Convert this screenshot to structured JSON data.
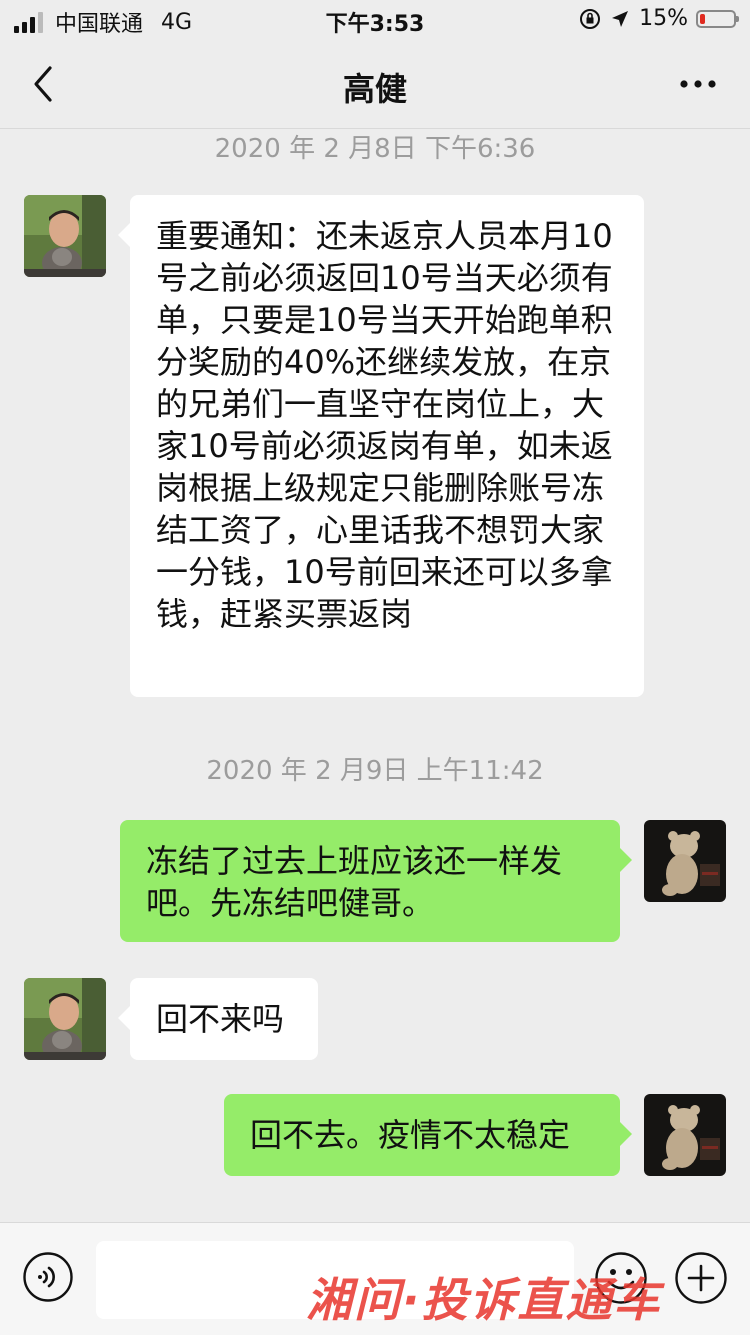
{
  "status_bar": {
    "carrier": "中国联通",
    "network": "4G",
    "time": "下午3:53",
    "battery_percent": "15%",
    "battery_level": 0.15,
    "battery_color": "#e02b20"
  },
  "nav": {
    "title": "高健",
    "back_icon": "chevron-left-icon",
    "more_icon": "ellipsis-icon"
  },
  "messages": [
    {
      "type": "timestamp",
      "text": "2020 年 2 月8日 下午6:36"
    },
    {
      "type": "incoming",
      "text": "重要通知：还未返京人员本月10号之前必须返回10号当天必须有单，只要是10号当天开始跑单积分奖励的40%还继续发放，在京的兄弟们一直坚守在岗位上，大家10号前必须返岗有单，如未返岗根据上级规定只能删除账号冻结工资了，心里话我不想罚大家一分钱，10号前回来还可以多拿钱，赶紧买票返岗"
    },
    {
      "type": "timestamp",
      "text": "2020 年 2 月9日 上午11:42"
    },
    {
      "type": "outgoing",
      "text": "冻结了过去上班应该还一样发吧。先冻结吧健哥。"
    },
    {
      "type": "incoming",
      "text": "回不来吗"
    },
    {
      "type": "outgoing",
      "text": "回不去。疫情不太稳定"
    }
  ],
  "input_bar": {
    "placeholder": "",
    "voice_icon": "voice-icon",
    "emoji_icon": "emoji-icon",
    "plus_icon": "plus-icon"
  },
  "watermark": {
    "text": "湘问·投诉直通车"
  },
  "colors": {
    "background": "#ededed",
    "incoming_bubble": "#ffffff",
    "outgoing_bubble": "#95ec69"
  }
}
